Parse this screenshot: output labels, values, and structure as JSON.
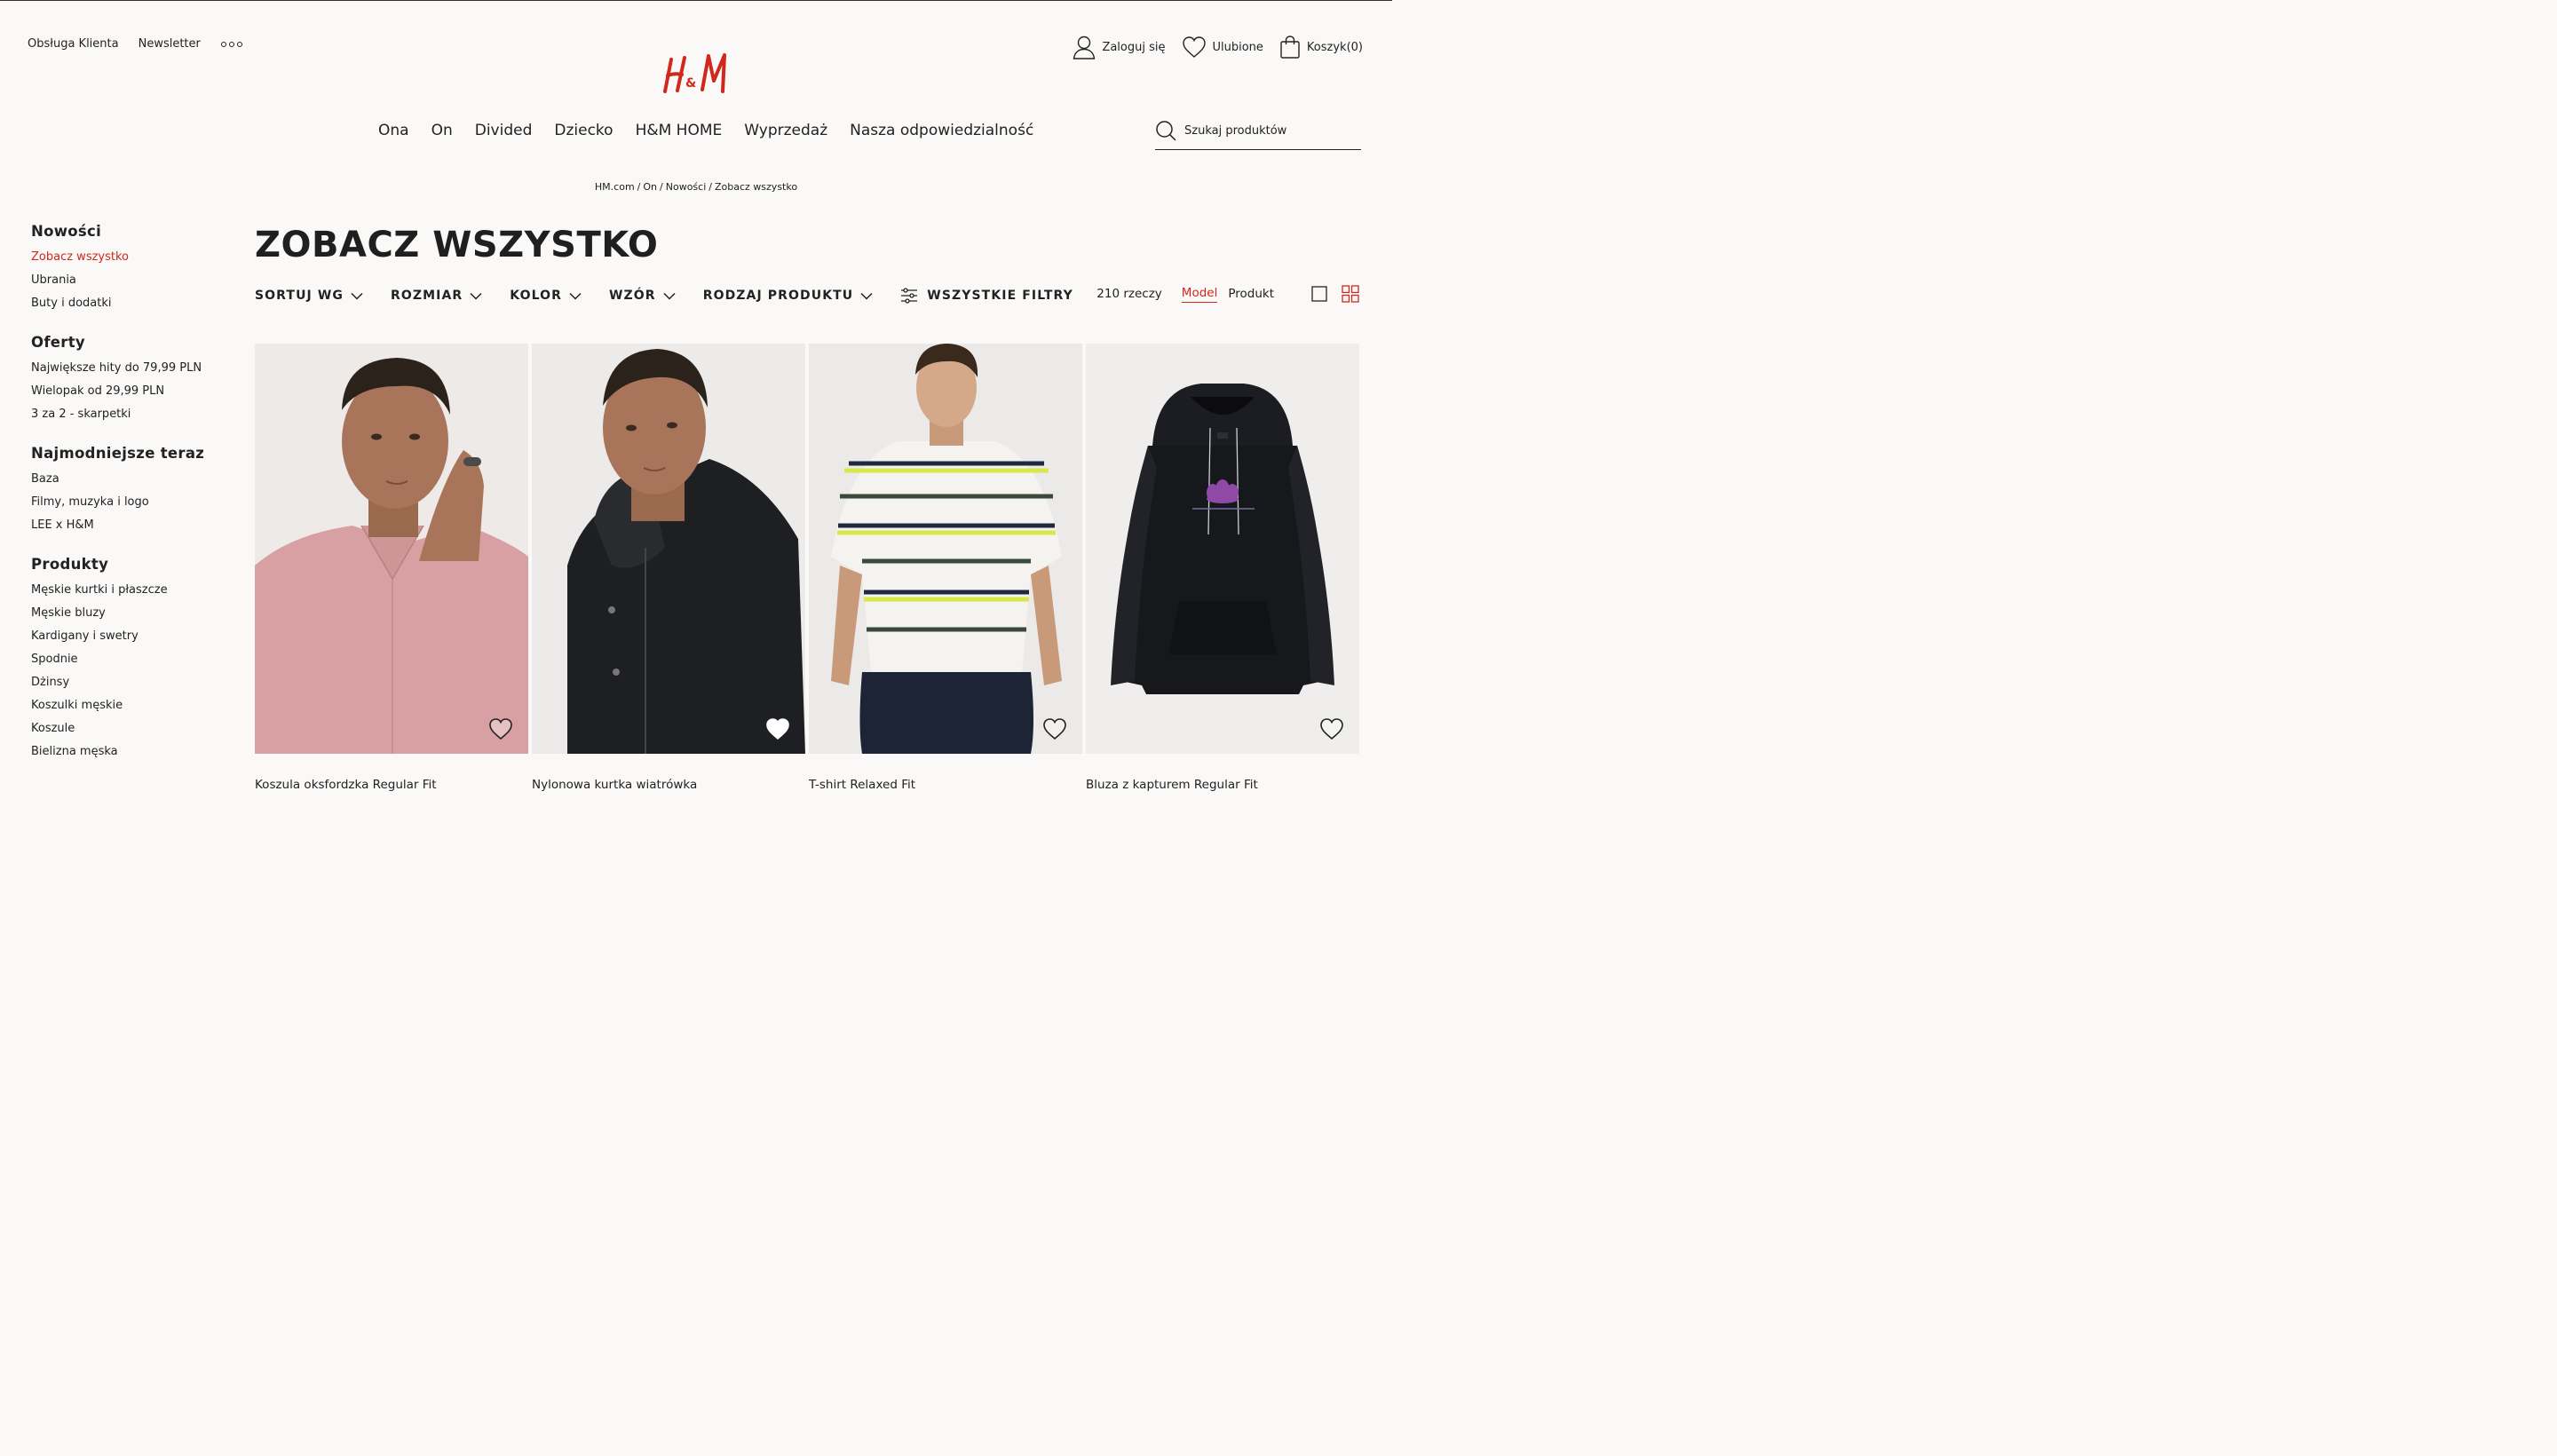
{
  "header": {
    "top_links": [
      "Obsługa Klienta",
      "Newsletter"
    ],
    "logo_text": "H&M",
    "account": {
      "login": "Zaloguj się",
      "favorites": "Ulubione",
      "cart": "Koszyk(0)"
    },
    "nav": [
      "Ona",
      "On",
      "Divided",
      "Dziecko",
      "H&M HOME",
      "Wyprzedaż",
      "Nasza odpowiedzialność"
    ],
    "search_placeholder": "Szukaj produktów"
  },
  "breadcrumb": [
    "HM.com",
    "On",
    "Nowości",
    "Zobacz wszystko"
  ],
  "sidebar": {
    "groups": [
      {
        "title": "Nowości",
        "items": [
          "Zobacz wszystko",
          "Ubrania",
          "Buty i dodatki"
        ]
      },
      {
        "title": "Oferty",
        "items": [
          "Największe hity do 79,99 PLN",
          "Wielopak od 29,99 PLN",
          "3 za 2 - skarpetki"
        ]
      },
      {
        "title": "Najmodniejsze teraz",
        "items": [
          "Baza",
          "Filmy, muzyka i logo",
          "LEE x H&M"
        ]
      },
      {
        "title": "Produkty",
        "items": [
          "Męskie kurtki i płaszcze",
          "Męskie bluzy",
          "Kardigany i swetry",
          "Spodnie",
          "Dżinsy",
          "Koszulki męskie",
          "Koszule",
          "Bielizna męska"
        ]
      }
    ],
    "active_item": "Zobacz wszystko"
  },
  "page_title": "ZOBACZ WSZYSTKO",
  "filters": [
    "SORTUJ WG",
    "ROZMIAR",
    "KOLOR",
    "WZÓR",
    "RODZAJ PRODUKTU"
  ],
  "all_filters": "WSZYSTKIE FILTRY",
  "results": {
    "count": "210 rzeczy",
    "view_model": "Model",
    "view_product": "Produkt",
    "active_view": "Model"
  },
  "products": [
    {
      "name": "Koszula oksfordzka Regular Fit",
      "image": "pink-oxford-shirt"
    },
    {
      "name": "Nylonowa kurtka wiatrówka",
      "image": "black-windbreaker"
    },
    {
      "name": "T-shirt Relaxed Fit",
      "image": "striped-tshirt"
    },
    {
      "name": "Bluza z kapturem Regular Fit",
      "image": "black-hoodie"
    }
  ],
  "colors": {
    "accent": "#d0281c",
    "background": "#faf9f8",
    "text": "#222222"
  }
}
